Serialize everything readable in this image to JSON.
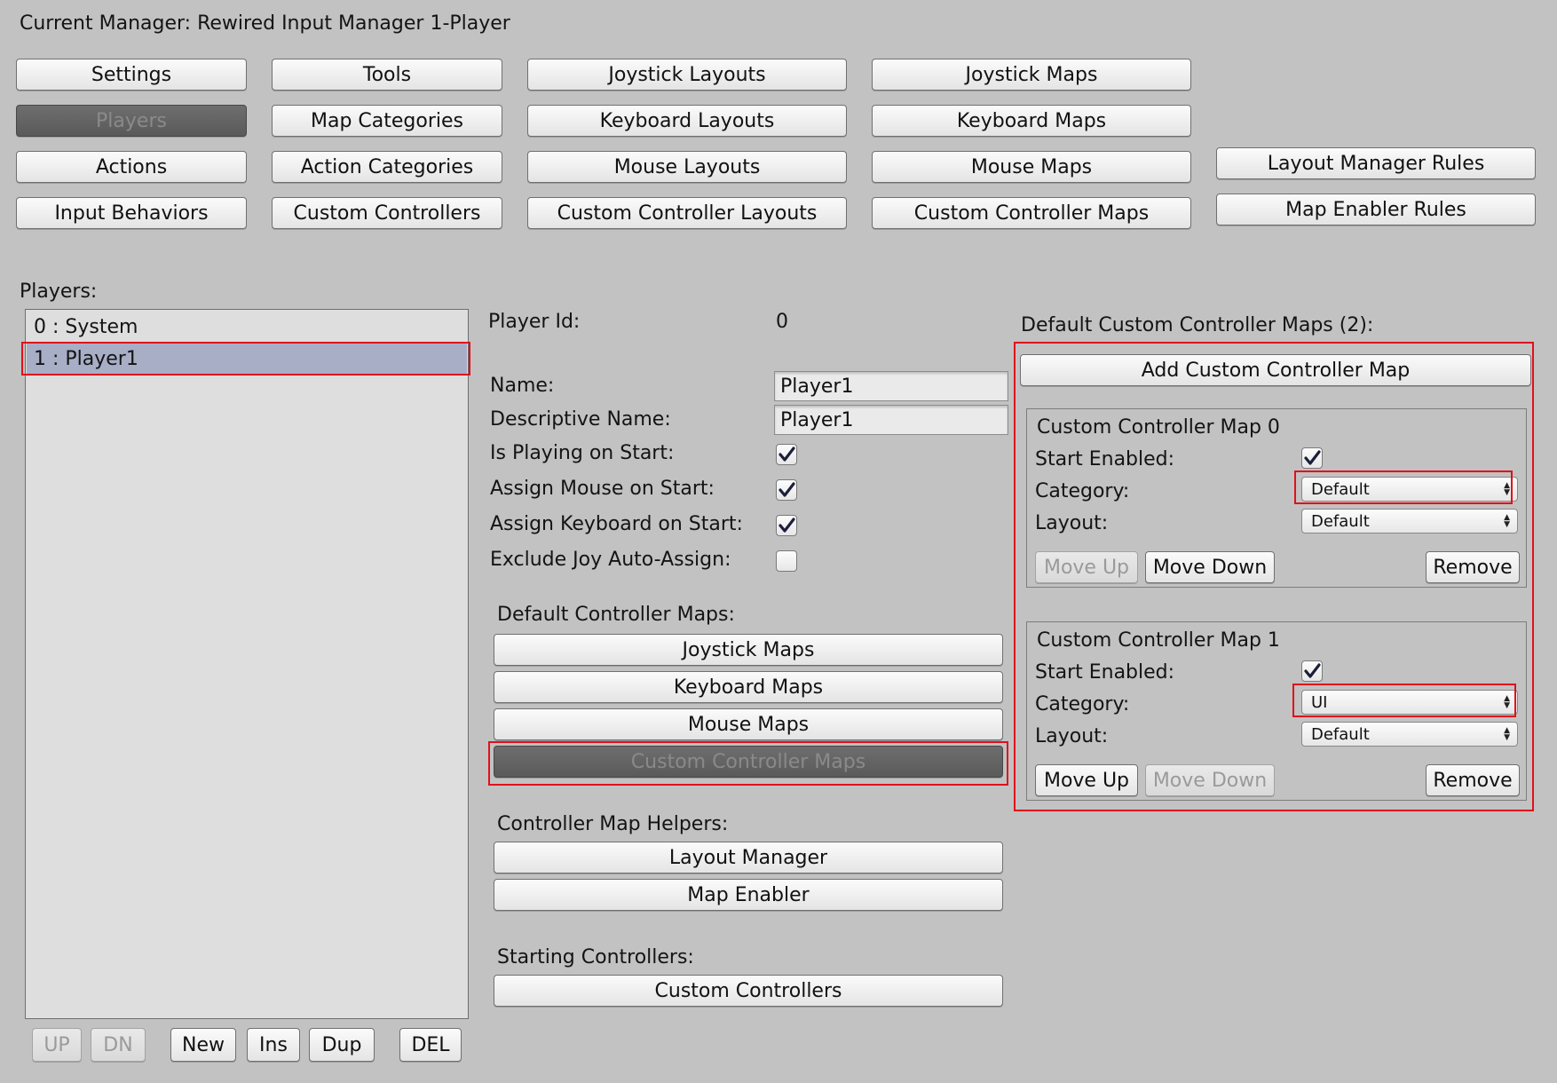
{
  "header": {
    "current_manager": "Current Manager: Rewired Input Manager 1-Player"
  },
  "nav": {
    "settings": "Settings",
    "tools": "Tools",
    "joystick_layouts": "Joystick Layouts",
    "joystick_maps": "Joystick Maps",
    "players": "Players",
    "map_categories": "Map Categories",
    "keyboard_layouts": "Keyboard Layouts",
    "keyboard_maps": "Keyboard Maps",
    "actions": "Actions",
    "action_categories": "Action Categories",
    "mouse_layouts": "Mouse Layouts",
    "mouse_maps": "Mouse Maps",
    "layout_manager_rules": "Layout Manager Rules",
    "input_behaviors": "Input Behaviors",
    "custom_controllers": "Custom Controllers",
    "custom_controller_layouts": "Custom Controller Layouts",
    "custom_controller_maps": "Custom Controller Maps",
    "map_enabler_rules": "Map Enabler Rules"
  },
  "players_panel": {
    "label": "Players:",
    "items": [
      "0 : System",
      "1 : Player1"
    ],
    "selected_index": 1,
    "buttons": {
      "up": "UP",
      "dn": "DN",
      "new": "New",
      "ins": "Ins",
      "dup": "Dup",
      "del": "DEL"
    }
  },
  "player": {
    "id_label": "Player Id:",
    "id_value": "0",
    "name_label": "Name:",
    "name_value": "Player1",
    "descriptive_name_label": "Descriptive Name:",
    "descriptive_name_value": "Player1",
    "is_playing_label": "Is Playing on Start:",
    "is_playing": true,
    "assign_mouse_label": "Assign Mouse on Start:",
    "assign_mouse": true,
    "assign_keyboard_label": "Assign Keyboard on Start:",
    "assign_keyboard": true,
    "exclude_joy_label": "Exclude Joy Auto-Assign:",
    "exclude_joy": false
  },
  "default_maps": {
    "label": "Default Controller Maps:",
    "joystick_maps": "Joystick Maps",
    "keyboard_maps": "Keyboard Maps",
    "mouse_maps": "Mouse Maps",
    "custom_controller_maps": "Custom Controller Maps"
  },
  "helpers": {
    "label": "Controller Map Helpers:",
    "layout_manager": "Layout Manager",
    "map_enabler": "Map Enabler"
  },
  "starting": {
    "label": "Starting Controllers:",
    "custom_controllers": "Custom Controllers"
  },
  "custom_maps": {
    "title": "Default Custom Controller Maps (2):",
    "add_button": "Add Custom Controller Map",
    "maps": [
      {
        "title": "Custom Controller Map 0",
        "start_enabled_label": "Start Enabled:",
        "start_enabled": true,
        "category_label": "Category:",
        "category": "Default",
        "layout_label": "Layout:",
        "layout": "Default",
        "move_up": "Move Up",
        "move_down": "Move Down",
        "remove": "Remove"
      },
      {
        "title": "Custom Controller Map 1",
        "start_enabled_label": "Start Enabled:",
        "start_enabled": true,
        "category_label": "Category:",
        "category": "UI",
        "layout_label": "Layout:",
        "layout": "Default",
        "move_up": "Move Up",
        "move_down": "Move Down",
        "remove": "Remove"
      }
    ]
  },
  "colors": {
    "background": "#c2c2c2",
    "highlight_box": "#e0101c",
    "selected_row": "#a8aec6",
    "active_button": "#5f5f5f"
  }
}
